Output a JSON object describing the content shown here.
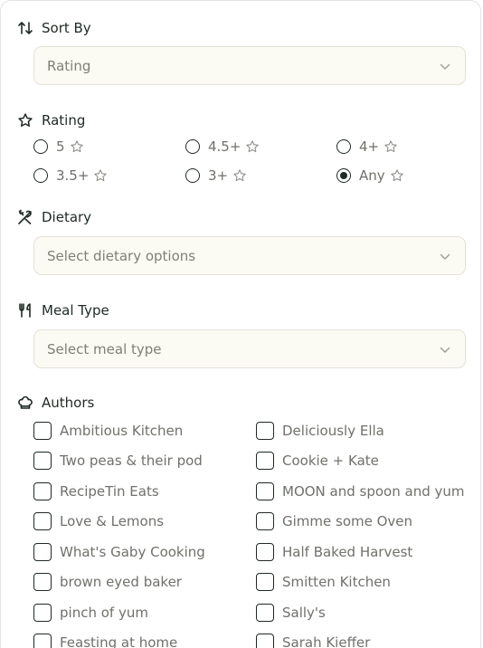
{
  "sort": {
    "title": "Sort By",
    "selected": "Rating"
  },
  "rating": {
    "title": "Rating",
    "options": [
      {
        "label": "5",
        "selected": false
      },
      {
        "label": "4.5+",
        "selected": false
      },
      {
        "label": "4+",
        "selected": false
      },
      {
        "label": "3.5+",
        "selected": false
      },
      {
        "label": "3+",
        "selected": false
      },
      {
        "label": "Any",
        "selected": true
      }
    ]
  },
  "dietary": {
    "title": "Dietary",
    "placeholder": "Select dietary options"
  },
  "meal_type": {
    "title": "Meal Type",
    "placeholder": "Select meal type"
  },
  "authors": {
    "title": "Authors",
    "items": [
      "Ambitious Kitchen",
      "Deliciously Ella",
      "Two peas & their pod",
      "Cookie + Kate",
      "RecipeTin Eats",
      "MOON and spoon and yum",
      "Love & Lemons",
      "Gimme some Oven",
      "What's Gaby Cooking",
      "Half Baked Harvest",
      "brown eyed baker",
      "Smitten Kitchen",
      "pinch of yum",
      "Sally's",
      "Feasting at home",
      "Sarah Kieffer"
    ]
  },
  "colors": {
    "text": "#1f2a24",
    "muted": "#6f716b",
    "select_bg": "#fcfbf3",
    "select_border": "#e3e1d6"
  }
}
